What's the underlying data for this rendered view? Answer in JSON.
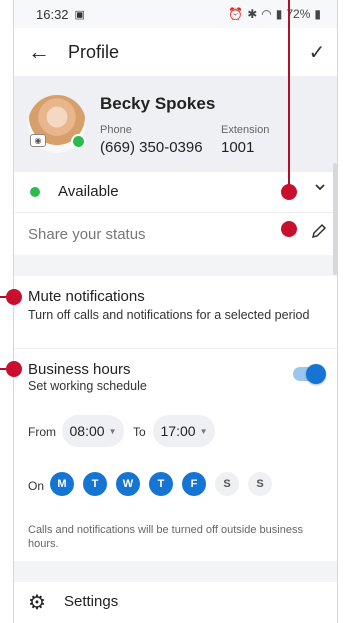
{
  "status_bar": {
    "time": "16:32",
    "battery": "72%"
  },
  "app_bar": {
    "title": "Profile"
  },
  "profile": {
    "name": "Becky Spokes",
    "phone_label": "Phone",
    "phone": "(669) 350-0396",
    "extension_label": "Extension",
    "extension": "1001"
  },
  "presence": {
    "status": "Available",
    "share_placeholder": "Share your status"
  },
  "mute": {
    "title": "Mute notifications",
    "subtitle": "Turn off calls and notifications for a selected period"
  },
  "business_hours": {
    "title": "Business hours",
    "subtitle": "Set working schedule",
    "enabled": true,
    "from_label": "From",
    "from_time": "08:00",
    "to_label": "To",
    "to_time": "17:00",
    "on_label": "On",
    "days": [
      {
        "label": "M",
        "active": true
      },
      {
        "label": "T",
        "active": true
      },
      {
        "label": "W",
        "active": true
      },
      {
        "label": "T",
        "active": true
      },
      {
        "label": "F",
        "active": true
      },
      {
        "label": "S",
        "active": false
      },
      {
        "label": "S",
        "active": false
      }
    ],
    "note": "Calls and notifications will be turned off outside business hours."
  },
  "settings": {
    "label": "Settings"
  },
  "colors": {
    "accent": "#1675d3",
    "available": "#2dbb4e",
    "annotation": "#c8102e"
  },
  "icons": [
    "back-arrow-icon",
    "check-icon",
    "chevron-down-icon",
    "pencil-icon",
    "gear-icon",
    "camera-icon"
  ]
}
